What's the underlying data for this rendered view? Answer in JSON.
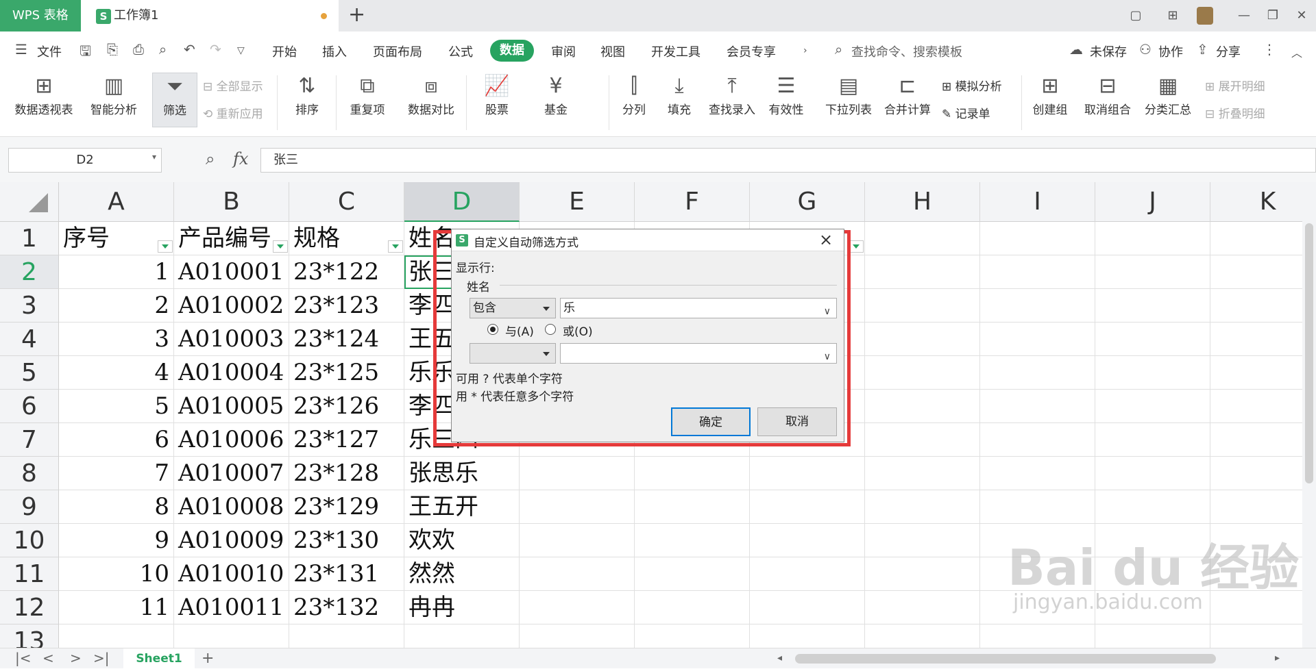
{
  "titlebar": {
    "app_tab": "WPS 表格",
    "doc_icon": "S",
    "doc_tab": "工作簿1",
    "new_tab": "+"
  },
  "menu": {
    "file": "文件",
    "tabs": [
      "开始",
      "插入",
      "页面布局",
      "公式",
      "数据",
      "审阅",
      "视图",
      "开发工具",
      "会员专享"
    ],
    "active": "数据",
    "search_placeholder": "查找命令、搜索模板",
    "unsaved": "未保存",
    "collab": "协作",
    "share": "分享"
  },
  "ribbon": {
    "pivot": "数据透视表",
    "smart": "智能分析",
    "filter": "筛选",
    "show_all": "全部显示",
    "reapply": "重新应用",
    "sort": "排序",
    "dup": "重复项",
    "compare": "数据对比",
    "stock": "股票",
    "fund": "基金",
    "split": "分列",
    "fill": "填充",
    "lookup": "查找录入",
    "validity": "有效性",
    "dropdown": "下拉列表",
    "consolidate": "合并计算",
    "whatif": "模拟分析",
    "record": "记录单",
    "group": "创建组",
    "ungroup": "取消组合",
    "subtotal": "分类汇总",
    "expand": "展开明细",
    "collapse": "折叠明细"
  },
  "formula_bar": {
    "name_box": "D2",
    "fx": "fx",
    "value": "张三"
  },
  "grid": {
    "columns": [
      "A",
      "B",
      "C",
      "D",
      "E",
      "F",
      "G",
      "H",
      "I",
      "J",
      "K"
    ],
    "rows": [
      "1",
      "2",
      "3",
      "4",
      "5",
      "6",
      "7",
      "8",
      "9",
      "10",
      "11",
      "12",
      "13"
    ],
    "header": [
      "序号",
      "产品编号",
      "规格",
      "姓名"
    ],
    "data": [
      [
        "1",
        "A010001",
        "23*122",
        "张三"
      ],
      [
        "2",
        "A010002",
        "23*123",
        "李四"
      ],
      [
        "3",
        "A010003",
        "23*124",
        "王五"
      ],
      [
        "4",
        "A010004",
        "23*125",
        "乐乐"
      ],
      [
        "5",
        "A010005",
        "23*126",
        "李四"
      ],
      [
        "6",
        "A010006",
        "23*127",
        "乐三四"
      ],
      [
        "7",
        "A010007",
        "23*128",
        "张思乐"
      ],
      [
        "8",
        "A010008",
        "23*129",
        "王五开"
      ],
      [
        "9",
        "A010009",
        "23*130",
        "欢欢"
      ],
      [
        "10",
        "A010010",
        "23*131",
        "然然"
      ],
      [
        "11",
        "A010011",
        "23*132",
        "冉冉"
      ]
    ]
  },
  "dialog": {
    "icon": "S",
    "title": "自定义自动筛选方式",
    "show_rows": "显示行:",
    "field": "姓名",
    "op1": "包含",
    "val1": "乐",
    "and_label": "与(A)",
    "or_label": "或(O)",
    "hint1": "可用 ? 代表单个字符",
    "hint2": "用 * 代表任意多个字符",
    "ok": "确定",
    "cancel": "取消",
    "close": "×"
  },
  "sheets": {
    "active": "Sheet1",
    "add": "+"
  },
  "watermark": {
    "brand": "Bai du 经验",
    "url": "jingyan.baidu.com"
  },
  "colors": {
    "accent": "#27a360",
    "highlight": "#e53a3a"
  }
}
